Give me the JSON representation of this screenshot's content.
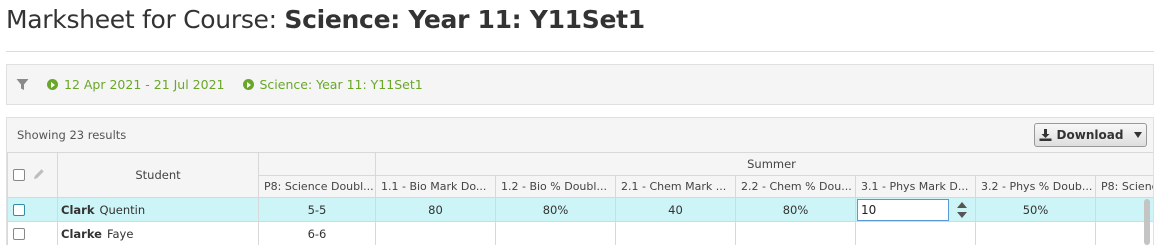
{
  "page": {
    "title_prefix": "Marksheet for Course: ",
    "title_course": "Science: Year 11: Y11Set1"
  },
  "filters": {
    "icon": "funnel-icon",
    "chips": [
      {
        "label": "12 Apr 2021 - 21 Jul 2021"
      },
      {
        "label": "Science: Year 11: Y11Set1"
      }
    ],
    "accent": "#6aa729"
  },
  "toolbar": {
    "result_count": "Showing 23 results",
    "download_label": "Download"
  },
  "grid": {
    "student_header": "Student",
    "group_header": "Summer",
    "columns": [
      "P8: Science Doubl...",
      "1.1 - Bio Mark Do...",
      "1.2 - Bio % Doubl...",
      "2.1 - Chem Mark ...",
      "2.2 - Chem % Dou...",
      "3.1 - Phys Mark D...",
      "3.2 - Phys % Doub...",
      "P8: Scienc"
    ],
    "rows": [
      {
        "surname": "Clark",
        "forename": "Quentin",
        "cells": [
          "5-5",
          "80",
          "80%",
          "40",
          "80%",
          "",
          "50%",
          ""
        ],
        "editing_value": "10"
      },
      {
        "surname": "Clarke",
        "forename": "Faye",
        "cells": [
          "6-6",
          "",
          "",
          "",
          "",
          "",
          "",
          ""
        ]
      }
    ],
    "highlight_color": "#cdf4f7"
  }
}
